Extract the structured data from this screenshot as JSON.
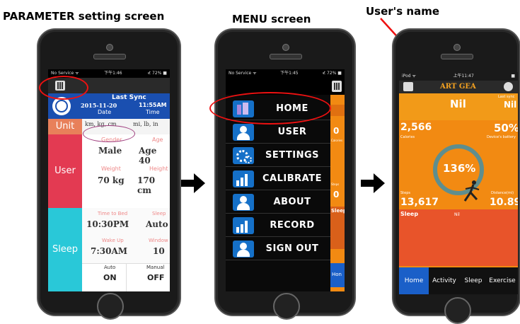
{
  "captions": {
    "parameter": "PARAMETER  setting screen",
    "menu": "MENU screen",
    "username": "User's name"
  },
  "screen1": {
    "status_left": "No Service ᯤ",
    "status_time": "下午1:46",
    "status_right": "⊀ 72% ■",
    "last_sync": "Last  Sync",
    "date_value": "2015-11-20",
    "date_label": "Date",
    "time_value": "11:55AM",
    "time_label": "Time",
    "unit_label": "Unit",
    "unit_metric": "km, kg, cm",
    "unit_imperial": "mi, lb, in",
    "user_label": "User",
    "gender_label": "Gender",
    "gender_value": "Male",
    "age_label": "Age",
    "age_value": "Age 40",
    "weight_label": "Weight",
    "weight_value": "70 kg",
    "height_label": "Height",
    "height_value": "170 cm",
    "sleep_label": "Sleep",
    "bed_label": "Time to Bed",
    "bed_value": "10:30PM",
    "mode1_label": "Sleep",
    "mode1_value": "Auto",
    "wake_label": "Wake Up",
    "wake_value": "7:30AM",
    "window_label": "Window",
    "window_value": "10",
    "auto_label": "Auto",
    "auto_value": "ON",
    "manual_label": "Manual",
    "manual_value": "OFF"
  },
  "screen2": {
    "status_left": "No Service ᯤ",
    "status_time": "下午1:45",
    "status_right": "⊀ 72% ■",
    "menu_items": [
      {
        "label": "HOME"
      },
      {
        "label": "USER"
      },
      {
        "label": "SETTINGS"
      },
      {
        "label": "CALIBRATE"
      },
      {
        "label": "ABOUT"
      },
      {
        "label": "RECORD"
      },
      {
        "label": "SIGN OUT"
      }
    ],
    "side_values": [
      "0",
      "0"
    ],
    "side_small": [
      "Calories",
      "Steps"
    ],
    "side_sleep": "Sleep",
    "side_home": "Hon"
  },
  "screen3": {
    "status_left": "iPod ᯤ",
    "status_time": "上午11:47",
    "status_right": "■",
    "username": "ART GEA",
    "nil_main": "Nil",
    "last_sync": "Last sync",
    "nil_right": "Nil",
    "calories_value": "2,566",
    "calories_label": "Calories",
    "battery_value": "50%",
    "battery_label": "Device's battery",
    "goal_pct": "136%",
    "steps_label": "Steps",
    "steps_value": "13,617",
    "distance_label": "Distance(mi)",
    "distance_value": "10.89",
    "sleep_label": "Sleep",
    "sleep_value": "Nil",
    "tabs": [
      "Home",
      "Activity",
      "Sleep",
      "Exercise"
    ]
  },
  "colors": {
    "red_highlight": "#e11111",
    "menu_icon_blue": "#1570c8",
    "orange": "#f28a12",
    "unit_orange": "#e8805a",
    "user_red": "#e33a52",
    "sleep_cyan": "#29c8d8",
    "tab_blue": "#1a5fc8"
  }
}
